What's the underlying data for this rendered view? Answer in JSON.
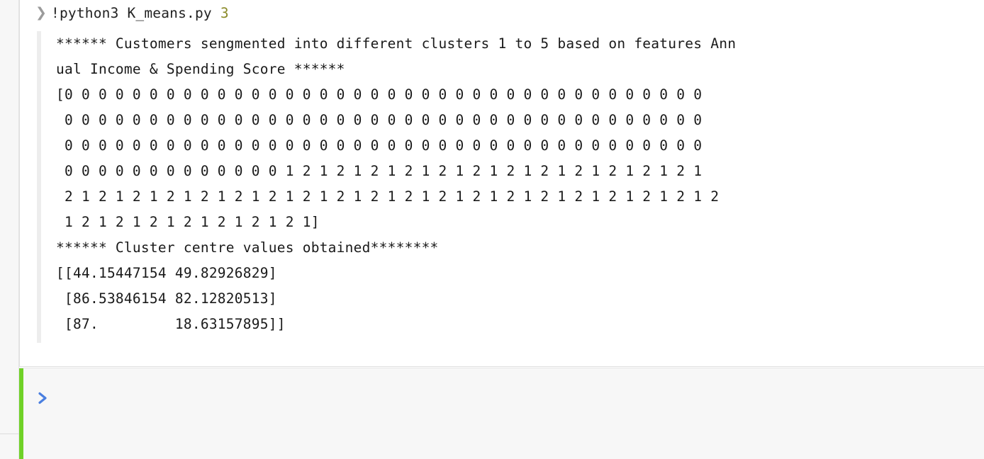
{
  "notebook": {
    "executed_cell": {
      "prompt_icon": "chevron-right-icon",
      "code": {
        "command": "!python3 K_means.py ",
        "argument": "3"
      },
      "output_lines": [
        "****** Customers sengmented into different clusters 1 to 5 based on features Ann",
        "ual Income & Spending Score ******",
        "[0 0 0 0 0 0 0 0 0 0 0 0 0 0 0 0 0 0 0 0 0 0 0 0 0 0 0 0 0 0 0 0 0 0 0 0 0 0",
        " 0 0 0 0 0 0 0 0 0 0 0 0 0 0 0 0 0 0 0 0 0 0 0 0 0 0 0 0 0 0 0 0 0 0 0 0 0 0",
        " 0 0 0 0 0 0 0 0 0 0 0 0 0 0 0 0 0 0 0 0 0 0 0 0 0 0 0 0 0 0 0 0 0 0 0 0 0 0",
        " 0 0 0 0 0 0 0 0 0 0 0 0 0 1 2 1 2 1 2 1 2 1 2 1 2 1 2 1 2 1 2 1 2 1 2 1 2 1",
        " 2 1 2 1 2 1 2 1 2 1 2 1 2 1 2 1 2 1 2 1 2 1 2 1 2 1 2 1 2 1 2 1 2 1 2 1 2 1 2",
        " 1 2 1 2 1 2 1 2 1 2 1 2 1 2 1]",
        "****** Cluster centre values obtained********",
        "[[44.15447154 49.82926829]",
        " [86.53846154 82.12820513]",
        " [87.         18.63157895]]"
      ],
      "cluster_centres": [
        [
          44.15447154,
          49.82926829
        ],
        [
          86.53846154,
          82.12820513
        ],
        [
          87.0,
          18.63157895
        ]
      ],
      "cluster_labels_summary": {
        "clusters_present": [
          0,
          1,
          2
        ],
        "header_text": "Customers sengmented into different clusters 1 to 5 based on features Annual Income & Spending Score",
        "centres_header_text": "Cluster centre values obtained"
      }
    },
    "active_cell": {
      "prompt_icon": "run-cell-icon",
      "content": "",
      "accent_color": "#6fd127"
    },
    "colors": {
      "page_background": "#ffffff",
      "gutter_background": "#f7f7f7",
      "output_bar": "#ededed",
      "active_cell_background": "#f7f7f7",
      "active_accent": "#6fd127",
      "run_icon_blue": "#4a7fe0",
      "number_token": "#8a8a28",
      "text": "#1a1a1a"
    }
  }
}
